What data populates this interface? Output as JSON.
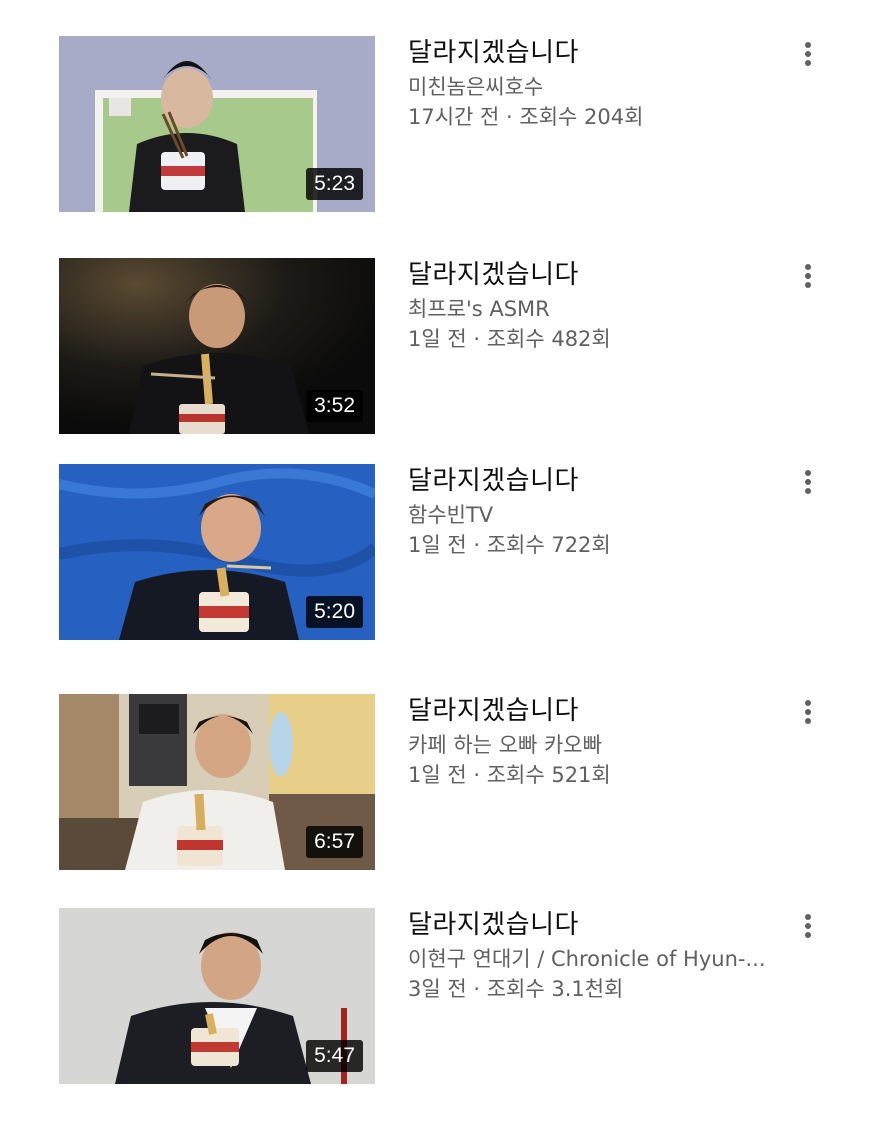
{
  "videos": [
    {
      "title": "달라지겠습니다",
      "channel": "미친놈은씨호수",
      "stats": "17시간 전 · 조회수 204회",
      "duration": "5:23",
      "thumbnail_icon": "thumbnail-man-eating-noodles-green-board"
    },
    {
      "title": "달라지겠습니다",
      "channel": "최프로's ASMR",
      "stats": "1일 전 · 조회수 482회",
      "duration": "3:52",
      "thumbnail_icon": "thumbnail-man-eating-noodles-dark-background"
    },
    {
      "title": "달라지겠습니다",
      "channel": "함수빈TV",
      "stats": "1일 전 · 조회수 722회",
      "duration": "5:20",
      "thumbnail_icon": "thumbnail-man-eating-noodles-blue-backdrop"
    },
    {
      "title": "달라지겠습니다",
      "channel": "카페 하는 오빠 카오빠",
      "stats": "1일 전 · 조회수 521회",
      "duration": "6:57",
      "thumbnail_icon": "thumbnail-man-eating-noodles-cafe"
    },
    {
      "title": "달라지겠습니다",
      "channel": "이현구 연대기 / Chronicle of Hyun-...",
      "stats": "3일 전 · 조회수 3.1천회",
      "duration": "5:47",
      "thumbnail_icon": "thumbnail-man-in-suit-eating-noodles"
    }
  ],
  "colors": {
    "title": "#0f0f0f",
    "secondary_text": "#606060",
    "duration_badge": "#000000"
  }
}
